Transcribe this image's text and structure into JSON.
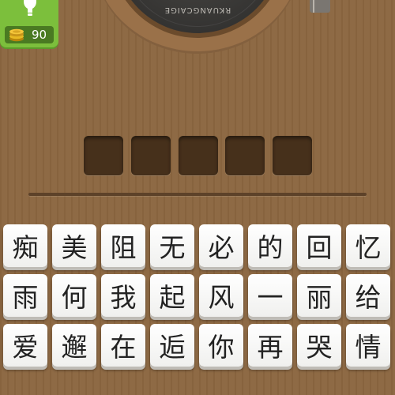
{
  "player": {
    "disc_label": "RKUANGCAIGE"
  },
  "hint": {
    "coins": "90",
    "icon": "lightbulb-icon",
    "coin_icon": "coin-stack-icon"
  },
  "answer": {
    "slots": 5
  },
  "tiles": {
    "rows": [
      [
        "痴",
        "美",
        "阻",
        "无",
        "必",
        "的",
        "回",
        "忆"
      ],
      [
        "雨",
        "何",
        "我",
        "起",
        "风",
        "一",
        "丽",
        "给"
      ],
      [
        "爱",
        "邂",
        "在",
        "逅",
        "你",
        "再",
        "哭",
        "情"
      ]
    ]
  },
  "colors": {
    "background": "#8c6741",
    "hint_panel": "#7cbf3c",
    "slot": "#46301b",
    "tile": "#ffffff"
  }
}
